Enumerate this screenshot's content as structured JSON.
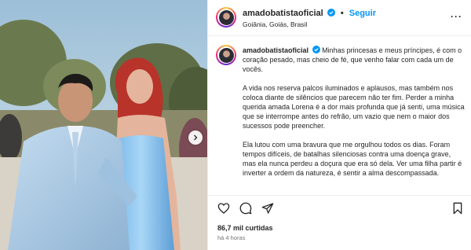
{
  "post": {
    "username": "amadobatistaoficial",
    "follow_label": "Seguir",
    "dot": "•",
    "location": "Goiânia, Goiás, Brasil",
    "more_label": "···"
  },
  "caption": {
    "username": "amadobatistaoficial",
    "paragraphs": [
      "Minhas princesas e meus príncipes, é com o coração pesado, mas cheio de fé, que venho falar com cada um de vocês.",
      "A vida nos reserva palcos iluminados e aplausos, mas também nos coloca diante de silêncios que parecem não ter fim. Perder a minha querida amada Lorena é a dor mais profunda que já senti, uma música que se interrompe antes do refrão, um vazio que nem o maior dos sucessos pode preencher.",
      "Ela lutou com uma bravura que me orgulhou todos os dias. Foram tempos difíceis, de batalhas silenciosas contra uma doença grave, mas ela nunca perdeu a doçura que era só dela. Ver uma filha partir é inverter a ordem da natureza, é sentir a alma descompassada."
    ]
  },
  "stats": {
    "likes": "86,7 mil curtidas",
    "time": "há 4 horas"
  },
  "icons": {
    "verified": "verified-badge-icon",
    "like": "heart-icon",
    "comment": "comment-icon",
    "share": "send-icon",
    "save": "bookmark-icon",
    "next": "chevron-right-icon"
  },
  "colors": {
    "accent": "#0095f6",
    "dress": "#8fc3ec",
    "suit": "#a9c9e6"
  }
}
